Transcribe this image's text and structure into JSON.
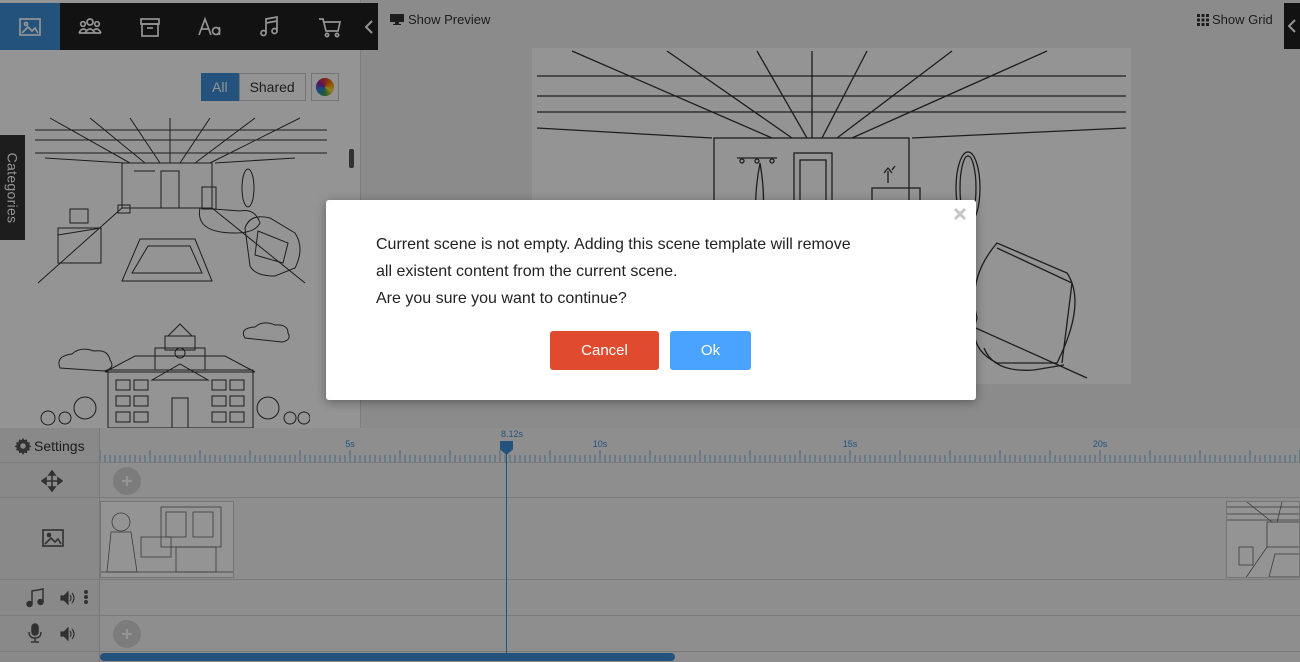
{
  "toolbar": {
    "tabs": [
      {
        "name": "scenes",
        "icon": "image-icon",
        "active": true
      },
      {
        "name": "characters",
        "icon": "people-icon",
        "active": false
      },
      {
        "name": "props",
        "icon": "box-icon",
        "active": false
      },
      {
        "name": "text",
        "icon": "text-icon",
        "active": false
      },
      {
        "name": "music",
        "icon": "music-note-icon",
        "active": false
      },
      {
        "name": "store",
        "icon": "cart-icon",
        "active": false
      }
    ],
    "collapse_icon": "chevron-left-icon"
  },
  "library": {
    "filter_all": "All",
    "filter_shared": "Shared",
    "active_filter": "All",
    "color_icon": "color-wheel-icon",
    "categories_label": "Categories"
  },
  "topbar": {
    "show_preview": "Show Preview",
    "show_grid": "Show Grid"
  },
  "timeline": {
    "settings_label": "Settings",
    "ticks": [
      "5s",
      "10s",
      "15s",
      "20s"
    ],
    "playhead": "8.12s",
    "rows": [
      "move-icon",
      "image-icon",
      "music-note-icon",
      "microphone-icon"
    ]
  },
  "dialog": {
    "line1": "Current scene is not empty. Adding this scene template will remove",
    "line2": "all existent content from the current scene.",
    "line3": "Are you sure you want to continue?",
    "cancel_label": "Cancel",
    "ok_label": "Ok"
  },
  "colors": {
    "accent": "#3d8fd6",
    "cancel": "#e04b30",
    "ok": "#4aa3ff",
    "toolbar": "#1f1f1f"
  }
}
